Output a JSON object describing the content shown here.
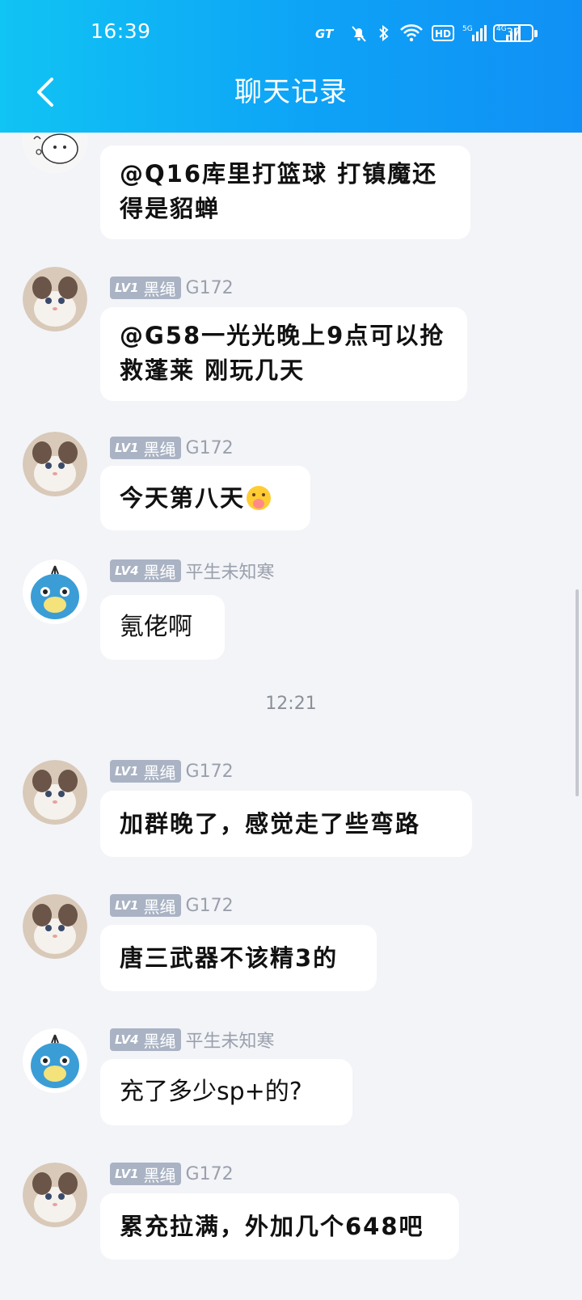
{
  "status": {
    "time": "16:39",
    "battery": "37"
  },
  "header": {
    "title": "聊天记录"
  },
  "timestamp": "12:21",
  "messages": [
    {
      "text": "@Q16库里打篮球 打镇魔还得是貂蝉"
    },
    {
      "level": "LV1",
      "tag": "黑绳",
      "sender": "G172",
      "text": "@G58一光光晚上9点可以抢救蓬莱 刚玩几天"
    },
    {
      "level": "LV1",
      "tag": "黑绳",
      "sender": "G172",
      "text": "今天第八天",
      "emoji": "praying-hands-emoji"
    },
    {
      "level": "LV4",
      "tag": "黑绳",
      "sender": "平生未知寒",
      "text": "氪佬啊"
    },
    {
      "level": "LV1",
      "tag": "黑绳",
      "sender": "G172",
      "text": "加群晚了，感觉走了些弯路"
    },
    {
      "level": "LV1",
      "tag": "黑绳",
      "sender": "G172",
      "text": "唐三武器不该精3的"
    },
    {
      "level": "LV4",
      "tag": "黑绳",
      "sender": "平生未知寒",
      "text": "充了多少sp+的?"
    },
    {
      "level": "LV1",
      "tag": "黑绳",
      "sender": "G172",
      "text": "累充拉满，外加几个648吧"
    }
  ],
  "icons": {
    "back": "chevron-left-icon",
    "status": [
      "gt-icon",
      "mute-bell-icon",
      "bluetooth-icon",
      "wifi-icon",
      "hd-icon",
      "signal-5g-icon",
      "signal-4g-icon",
      "battery-icon"
    ]
  },
  "colors": {
    "header_start": "#10c4f4",
    "header_end": "#1090f5",
    "badge": "#aab3c4",
    "background": "#f3f4f8"
  }
}
